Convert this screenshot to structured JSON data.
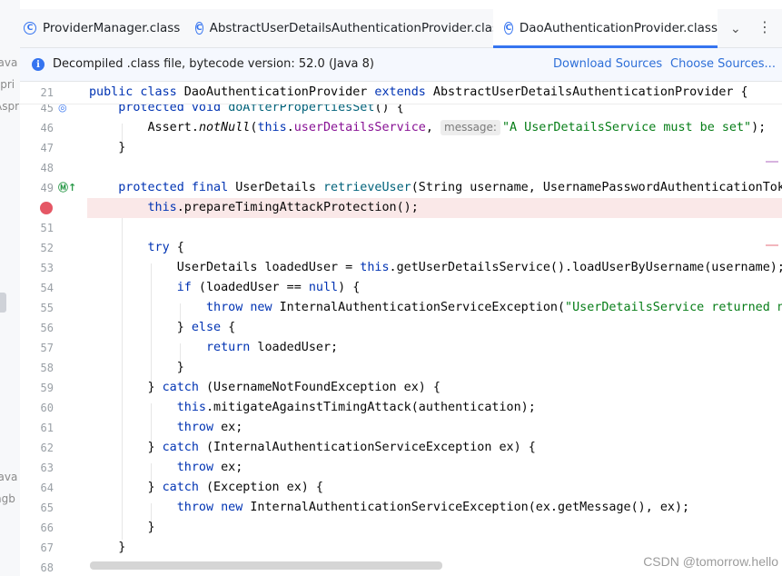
{
  "left_strip": {
    "fragments": [
      "Java",
      "spri",
      "Aspr",
      "Java",
      "ngb"
    ]
  },
  "tabs": [
    {
      "label": "ProviderManager.class",
      "active": false
    },
    {
      "label": "AbstractUserDetailsAuthenticationProvider.class",
      "active": false
    },
    {
      "label": "DaoAuthenticationProvider.class",
      "active": true
    }
  ],
  "banner": {
    "message": "Decompiled .class file, bytecode version: 52.0 (Java 8)",
    "download_sources": "Download Sources",
    "choose_sources": "Choose Sources..."
  },
  "editor": {
    "header_line": {
      "number": "21",
      "text": "public class DaoAuthenticationProvider extends AbstractUserDetailsAuthenticationProvider {"
    },
    "lines": [
      {
        "number": "45",
        "text": "    protected void doAfterPropertiesSet() {"
      },
      {
        "number": "46",
        "text": "        Assert.notNull(this.userDetailsService, message: \"A UserDetailsService must be set\");"
      },
      {
        "number": "47",
        "text": "    }"
      },
      {
        "number": "48",
        "text": ""
      },
      {
        "number": "49",
        "text": "    protected final UserDetails retrieveUser(String username, UsernamePasswordAuthenticationTok"
      },
      {
        "number": "",
        "text": "        this.prepareTimingAttackProtection();"
      },
      {
        "number": "51",
        "text": ""
      },
      {
        "number": "52",
        "text": "        try {"
      },
      {
        "number": "53",
        "text": "            UserDetails loadedUser = this.getUserDetailsService().loadUserByUsername(username);"
      },
      {
        "number": "54",
        "text": "            if (loadedUser == null) {"
      },
      {
        "number": "55",
        "text": "                throw new InternalAuthenticationServiceException(\"UserDetailsService returned n"
      },
      {
        "number": "56",
        "text": "            } else {"
      },
      {
        "number": "57",
        "text": "                return loadedUser;"
      },
      {
        "number": "58",
        "text": "            }"
      },
      {
        "number": "59",
        "text": "        } catch (UsernameNotFoundException ex) {"
      },
      {
        "number": "60",
        "text": "            this.mitigateAgainstTimingAttack(authentication);"
      },
      {
        "number": "61",
        "text": "            throw ex;"
      },
      {
        "number": "62",
        "text": "        } catch (InternalAuthenticationServiceException ex) {"
      },
      {
        "number": "63",
        "text": "            throw ex;"
      },
      {
        "number": "64",
        "text": "        } catch (Exception ex) {"
      },
      {
        "number": "65",
        "text": "            throw new InternalAuthenticationServiceException(ex.getMessage(), ex);"
      },
      {
        "number": "66",
        "text": "        }"
      },
      {
        "number": "67",
        "text": "    }"
      },
      {
        "number": "68",
        "text": ""
      }
    ]
  },
  "watermark": "CSDN @tomorrow.hello",
  "colors": {
    "accent": "#3574f0",
    "breakpoint": "#e55765",
    "keyword": "#0033b3",
    "string": "#067d17"
  }
}
